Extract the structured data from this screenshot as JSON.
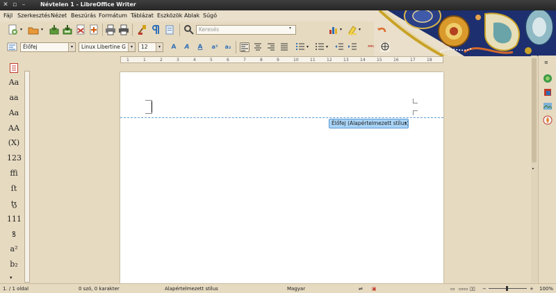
{
  "window": {
    "title": "Névtelen 1 - LibreOffice Writer"
  },
  "menu": [
    "Fájl",
    "Szerkesztés",
    "Nézet",
    "Beszúrás",
    "Formátum",
    "Táblázat",
    "Eszközök",
    "Ablak",
    "Súgó"
  ],
  "toolbar": {
    "search_placeholder": "Keresés"
  },
  "formatting": {
    "paragraph_style": "Élőfej",
    "font_name": "Linux Libertine G",
    "font_size": "12"
  },
  "ruler": {
    "ticks": [
      "1",
      "1",
      "2",
      "3",
      "4",
      "5",
      "6",
      "7",
      "8",
      "9",
      "10",
      "11",
      "12",
      "13",
      "14",
      "15",
      "16",
      "17",
      "18"
    ]
  },
  "left_glyphs": [
    "Aa",
    "aa",
    "Aa",
    "AA",
    "(X)",
    "123",
    "ffi",
    "ſt",
    "ꜩ",
    "111",
    "ꝸ",
    "a²",
    "b₂"
  ],
  "document": {
    "header_tag": "Élőfej (Alapértelmezett stílus)"
  },
  "status": {
    "page": "1. / 1 oldal",
    "words": "0 szó, 0 karakter",
    "style": "Alapértelmezett stílus",
    "language": "Magyar",
    "zoom": "100%"
  },
  "colors": {
    "accent": "#4a90d9",
    "header_tag_bg": "#a9d4f7"
  }
}
